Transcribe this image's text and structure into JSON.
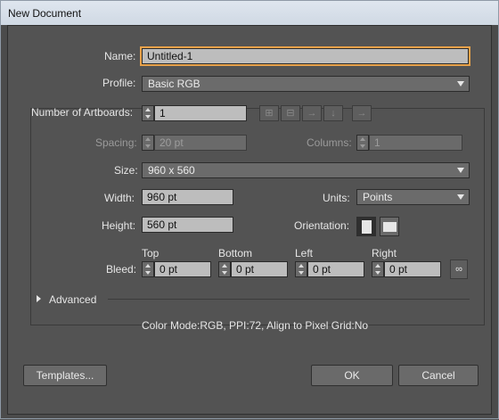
{
  "window": {
    "title": "New Document"
  },
  "name": {
    "label": "Name:",
    "value": "Untitled-1"
  },
  "profile": {
    "label": "Profile:",
    "value": "Basic RGB"
  },
  "artboards": {
    "label": "Number of Artboards:",
    "value": "1"
  },
  "spacing": {
    "label": "Spacing:",
    "value": "20 pt"
  },
  "columns": {
    "label": "Columns:",
    "value": "1"
  },
  "size": {
    "label": "Size:",
    "value": "960 x 560"
  },
  "width": {
    "label": "Width:",
    "value": "960 pt"
  },
  "units": {
    "label": "Units:",
    "value": "Points"
  },
  "height": {
    "label": "Height:",
    "value": "560 pt"
  },
  "orientation": {
    "label": "Orientation:",
    "selected": "portrait"
  },
  "bleed": {
    "label": "Bleed:",
    "top_label": "Top",
    "top": "0 pt",
    "bottom_label": "Bottom",
    "bottom": "0 pt",
    "left_label": "Left",
    "left": "0 pt",
    "right_label": "Right",
    "right": "0 pt"
  },
  "advanced": {
    "label": "Advanced"
  },
  "summary": "Color Mode:RGB, PPI:72, Align to Pixel Grid:No",
  "buttons": {
    "templates": "Templates...",
    "ok": "OK",
    "cancel": "Cancel"
  },
  "icons": {
    "grid_row": "grid-by-row-icon",
    "grid_col": "grid-by-column-icon",
    "arrange_row": "arrange-row-icon",
    "arrange_col": "arrange-column-icon",
    "rtl": "right-to-left-icon",
    "link": "link-icon"
  }
}
